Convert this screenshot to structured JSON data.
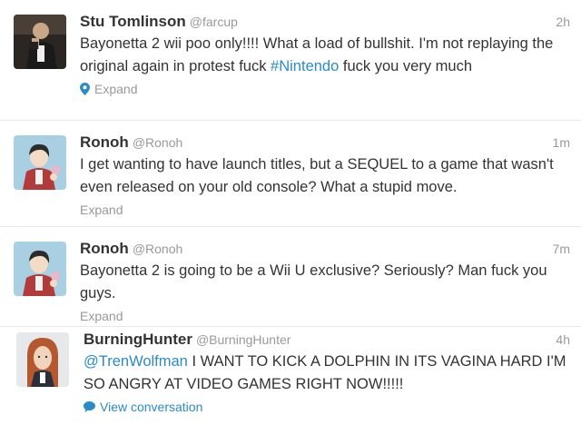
{
  "tweets": [
    {
      "fullname": "Stu Tomlinson",
      "username": "@farcup",
      "time": "2h",
      "text_before": "Bayonetta 2 wii poo only!!!! What a load of bullshit. I'm not replaying the original again in protest fuck ",
      "hashtag": "#Nintendo",
      "text_after": " fuck you very much",
      "action": "Expand",
      "action_icon": "location-pin-icon"
    },
    {
      "fullname": "Ronoh",
      "username": "@Ronoh",
      "time": "1m",
      "text": "I get wanting to have launch titles, but a SEQUEL to a game that wasn't even released on your old console? What a stupid move.",
      "action": "Expand"
    },
    {
      "fullname": "Ronoh",
      "username": "@Ronoh",
      "time": "7m",
      "text": "Bayonetta 2 is going to be a Wii U exclusive? Seriously? Man fuck you guys.",
      "action": "Expand"
    },
    {
      "fullname": "BurningHunter",
      "username": "@BurningHunter",
      "time": "4h",
      "mention": "@TrenWolfman",
      "text_after": " I WANT TO KICK A DOLPHIN IN ITS VAGINA HARD I'M SO ANGRY AT VIDEO GAMES RIGHT NOW!!!!!",
      "action": "View conversation",
      "action_icon": "speech-bubble-icon"
    }
  ],
  "colors": {
    "link": "#2a8bc8",
    "meta": "#999999",
    "text": "#333333",
    "divider": "#e8e8e8"
  }
}
